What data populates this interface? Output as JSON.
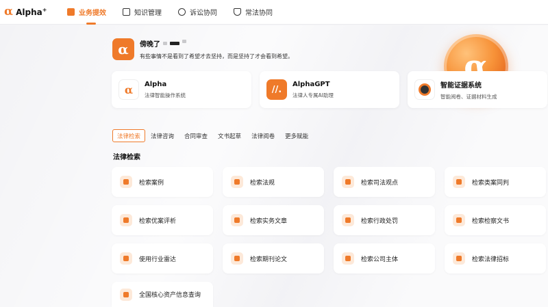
{
  "app": {
    "logo_glyph": "α",
    "name": "Alpha",
    "name_sup": "+",
    "accent": "#ef7a2a"
  },
  "nav": [
    {
      "label": "业务提效",
      "icon": "chart-icon",
      "active": true
    },
    {
      "label": "知识管理",
      "icon": "book-icon",
      "active": false
    },
    {
      "label": "诉讼协同",
      "icon": "gavel-icon",
      "active": false
    },
    {
      "label": "常法协同",
      "icon": "shield-icon",
      "active": false
    }
  ],
  "user": {
    "avatar_glyph": "α",
    "greeting": "傍晚了",
    "motto": "有些事情不是看到了希望才去坚持，而是坚持了才会看到希望。"
  },
  "hero_logo_glyph": "α",
  "products": [
    {
      "title": "Alpha",
      "subtitle": "法律智能操作系统",
      "icon": "alpha-logo-icon",
      "icon_text": "α"
    },
    {
      "title": "AlphaGPT",
      "subtitle": "法律人专属AI助理",
      "icon": "alphagpt-logo-icon",
      "icon_text": "//."
    },
    {
      "title": "智能证据系统",
      "subtitle": "智能阅卷、证据材料生成",
      "icon": "evidence-logo-icon",
      "icon_text": ""
    }
  ],
  "tabs": [
    "法律检索",
    "法律咨询",
    "合同审查",
    "文书起草",
    "法律阅卷",
    "更多赋能"
  ],
  "section_title": "法律检索",
  "features": [
    {
      "label": "检索案例",
      "icon": "case-icon"
    },
    {
      "label": "检索法规",
      "icon": "regulation-icon"
    },
    {
      "label": "检索司法观点",
      "icon": "judicial-view-icon"
    },
    {
      "label": "检索类案同判",
      "icon": "similar-case-icon"
    },
    {
      "label": "检索优案评析",
      "icon": "case-review-icon"
    },
    {
      "label": "检索实务文章",
      "icon": "article-icon"
    },
    {
      "label": "检索行政处罚",
      "icon": "penalty-icon"
    },
    {
      "label": "检索检察文书",
      "icon": "procuratorate-doc-icon"
    },
    {
      "label": "使用行业雷达",
      "icon": "radar-icon"
    },
    {
      "label": "检索期刊论文",
      "icon": "journal-icon"
    },
    {
      "label": "检索公司主体",
      "icon": "company-icon"
    },
    {
      "label": "检索法律招标",
      "icon": "tender-icon"
    },
    {
      "label": "全国核心资产信息查询",
      "icon": "asset-icon"
    }
  ]
}
